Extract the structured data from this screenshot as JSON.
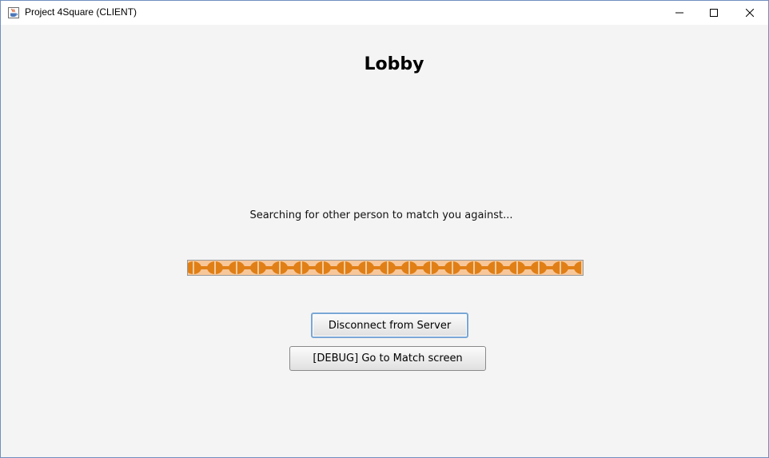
{
  "window": {
    "title": "Project 4Square (CLIENT)",
    "icons": {
      "app": "java-cup-icon",
      "minimize": "minimize-icon",
      "maximize": "maximize-icon",
      "close": "close-icon"
    }
  },
  "lobby": {
    "title": "Lobby",
    "status": "Searching for other person to match you against...",
    "progress": {
      "mode": "indeterminate",
      "color": "#e07f16"
    }
  },
  "buttons": {
    "disconnect": "Disconnect from Server",
    "debug_match": "[DEBUG] Go to Match screen"
  }
}
